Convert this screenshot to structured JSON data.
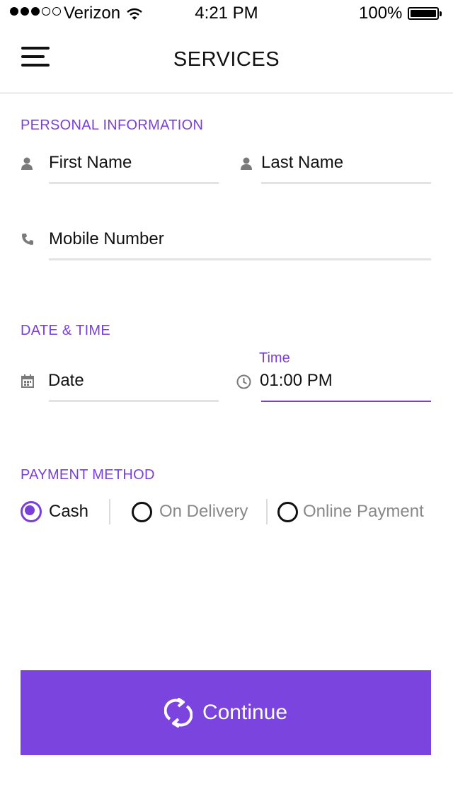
{
  "status_bar": {
    "carrier": "Verizon",
    "time": "4:21 PM",
    "battery": "100%"
  },
  "header": {
    "title": "SERVICES"
  },
  "personal": {
    "heading": "PERSONAL INFORMATION",
    "first_name_placeholder": "First Name",
    "last_name_placeholder": "Last Name",
    "mobile_placeholder": "Mobile Number"
  },
  "datetime": {
    "heading": "DATE & TIME",
    "date_placeholder": "Date",
    "time_label": "Time",
    "time_value": "01:00 PM"
  },
  "payment": {
    "heading": "PAYMENT METHOD",
    "options": [
      {
        "label": "Cash",
        "selected": true
      },
      {
        "label": "On Delivery",
        "selected": false
      },
      {
        "label": "Online Payment",
        "selected": false
      }
    ]
  },
  "continue_label": "Continue",
  "colors": {
    "accent": "#7b44de",
    "label_purple": "#7b3fd9",
    "muted_text": "#888888"
  }
}
